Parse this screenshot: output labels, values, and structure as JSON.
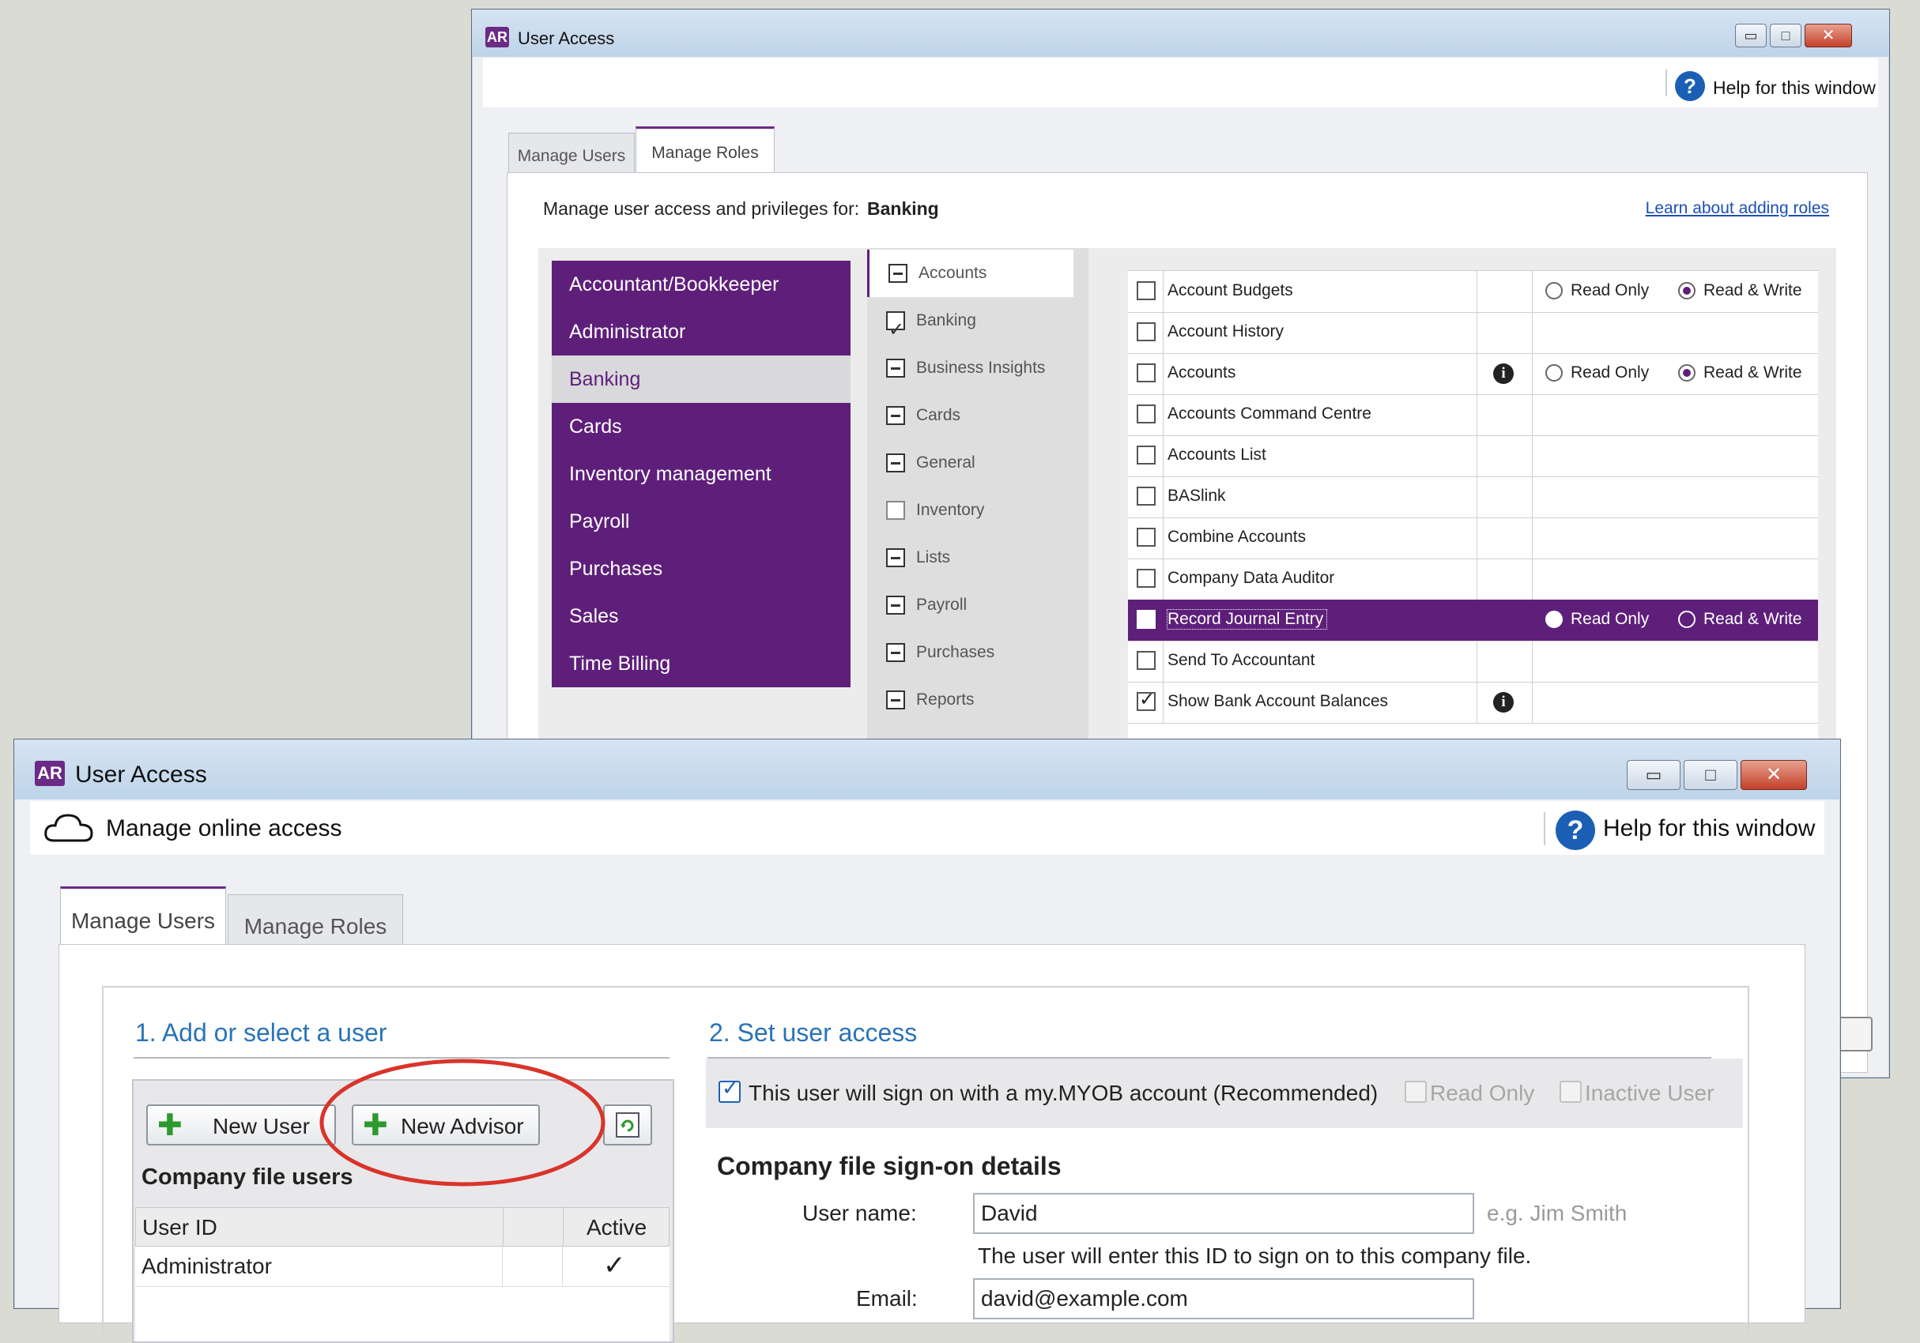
{
  "back_window": {
    "app_badge": "AR",
    "title": "User Access",
    "help_label": "Help for this window",
    "help_icon": "question-icon",
    "tabs": [
      {
        "label": "Manage Users",
        "active": false
      },
      {
        "label": "Manage Roles",
        "active": true
      }
    ],
    "manage_for_label": "Manage user access and privileges for:",
    "manage_for_value": "Banking",
    "learn_link": "Learn about adding roles",
    "roles": [
      "Accountant/Bookkeeper",
      "Administrator",
      "Banking",
      "Cards",
      "Inventory management",
      "Payroll",
      "Purchases",
      "Sales",
      "Time Billing"
    ],
    "selected_role": "Banking",
    "categories": [
      {
        "label": "Accounts",
        "state": "minus"
      },
      {
        "label": "Banking",
        "state": "check"
      },
      {
        "label": "Business Insights",
        "state": "minus"
      },
      {
        "label": "Cards",
        "state": "minus"
      },
      {
        "label": "General",
        "state": "minus"
      },
      {
        "label": "Inventory",
        "state": "empty"
      },
      {
        "label": "Lists",
        "state": "minus"
      },
      {
        "label": "Payroll",
        "state": "minus"
      },
      {
        "label": "Purchases",
        "state": "minus"
      },
      {
        "label": "Reports",
        "state": "minus"
      }
    ],
    "permissions": [
      {
        "name": "Account Budgets",
        "checked": false,
        "info": false,
        "radios": true,
        "read_write": true
      },
      {
        "name": "Account History",
        "checked": false,
        "info": false,
        "radios": false
      },
      {
        "name": "Accounts",
        "checked": false,
        "info": true,
        "radios": true,
        "read_write": true
      },
      {
        "name": "Accounts Command Centre",
        "checked": false,
        "info": false,
        "radios": false
      },
      {
        "name": "Accounts List",
        "checked": false,
        "info": false,
        "radios": false
      },
      {
        "name": "BASlink",
        "checked": false,
        "info": false,
        "radios": false
      },
      {
        "name": "Combine Accounts",
        "checked": false,
        "info": false,
        "radios": false
      },
      {
        "name": "Company Data Auditor",
        "checked": false,
        "info": false,
        "radios": false
      },
      {
        "name": "Record Journal Entry",
        "checked": false,
        "info": false,
        "radios": true,
        "read_write": false,
        "selected": true
      },
      {
        "name": "Send To Accountant",
        "checked": false,
        "info": false,
        "radios": false
      },
      {
        "name": "Show Bank Account Balances",
        "checked": true,
        "info": true,
        "radios": false
      }
    ],
    "radio_read_only": "Read Only",
    "radio_read_write": "Read & Write",
    "info_glyph": "i"
  },
  "front_window": {
    "app_badge": "AR",
    "title": "User Access",
    "online_icon": "cloud-icon",
    "online_label": "Manage online access",
    "help_label": "Help for this window",
    "help_icon": "question-icon",
    "tabs": [
      {
        "label": "Manage Users",
        "active": true
      },
      {
        "label": "Manage Roles",
        "active": false
      }
    ],
    "section1_title": "1. Add or select a user",
    "section2_title": "2. Set user access",
    "new_user_label": "New User",
    "new_advisor_label": "New Advisor",
    "refresh_icon": "refresh-icon",
    "users_heading": "Company file users",
    "columns": [
      "User ID",
      "",
      "Active"
    ],
    "users": [
      {
        "id": "Administrator",
        "active": "✓"
      }
    ],
    "myob_checkbox_label": "This user will sign on with a my.MYOB account (Recommended)",
    "read_only_label": "Read Only",
    "inactive_user_label": "Inactive User",
    "signon_heading": "Company file sign-on details",
    "username_label": "User name:",
    "username_value": "David",
    "username_hint": "e.g. Jim Smith",
    "username_note": "The user will enter this ID to sign on to this company file.",
    "email_label": "Email:",
    "email_value": "david@example.com"
  },
  "colors": {
    "brand_purple": "#5e1f7a",
    "section_blue": "#2a73b8",
    "highlight_red": "#d9342b",
    "help_blue": "#1b5fb5"
  }
}
